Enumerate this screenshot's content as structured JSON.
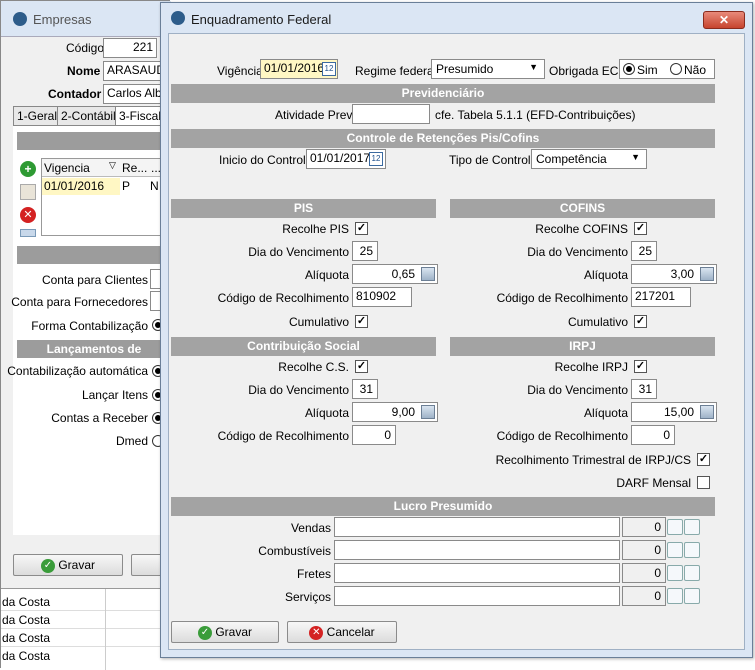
{
  "bg": {
    "title": "Empresas",
    "codigo_label": "Código",
    "codigo_value": "221",
    "nome_label": "Nome",
    "nome_value": "ARASAUDE",
    "contador_label": "Contador",
    "contador_value": "Carlos Alber",
    "tabs": [
      "1-Geral",
      "2-Contábil",
      "3-Fiscal"
    ],
    "grid_headers": [
      "Vigencia",
      "Re...",
      "..."
    ],
    "grid_row": [
      "01/01/2016",
      "P",
      "N"
    ],
    "conta_clientes": "Conta para Clientes",
    "conta_fornecedores": "Conta para Fornecedores",
    "forma_contab": "Forma Contabilização",
    "lanc_header": "Lançamentos de",
    "contab_auto": "Contabilização automática",
    "lancar_itens": "Lançar Itens",
    "contas_receber": "Contas a Receber",
    "dmed": "Dmed",
    "gravar": "Gravar",
    "rows": [
      "da Costa",
      "da Costa",
      "da Costa",
      "da Costa"
    ]
  },
  "dialog": {
    "title": "Enquadramento Federal",
    "vigencia_label": "Vigência",
    "vigencia_value": "01/01/2016",
    "regime_label": "Regime federal",
    "regime_value": "Presumido",
    "ecd_label": "Obrigada ECD",
    "ecd_sim": "Sim",
    "ecd_nao": "Não",
    "prev_header": "Previdenciário",
    "atividade_label": "Atividade Prev.",
    "atividade_value": "",
    "cfe_text": "cfe. Tabela 5.1.1 (EFD-Contribuições)",
    "retencoes_header": "Controle de Retenções Pis/Cofins",
    "inicio_label": "Inicio do Controle",
    "inicio_value": "01/01/2017",
    "tipo_label": "Tipo de Controle",
    "tipo_value": "Competência",
    "pis": {
      "header": "PIS",
      "recolhe_label": "Recolhe PIS",
      "dia_label": "Dia do Vencimento",
      "dia_value": "25",
      "aliquota_label": "Alíquota",
      "aliquota_value": "0,65",
      "codigo_label": "Código de Recolhimento",
      "codigo_value": "810902",
      "cumulativo_label": "Cumulativo"
    },
    "cofins": {
      "header": "COFINS",
      "recolhe_label": "Recolhe COFINS",
      "dia_label": "Dia do Vencimento",
      "dia_value": "25",
      "aliquota_label": "Alíquota",
      "aliquota_value": "3,00",
      "codigo_label": "Código de Recolhimento",
      "codigo_value": "217201",
      "cumulativo_label": "Cumulativo"
    },
    "cs": {
      "header": "Contribuição Social",
      "recolhe_label": "Recolhe C.S.",
      "dia_label": "Dia do Vencimento",
      "dia_value": "31",
      "aliquota_label": "Alíquota",
      "aliquota_value": "9,00",
      "codigo_label": "Código de Recolhimento",
      "codigo_value": "0"
    },
    "irpj": {
      "header": "IRPJ",
      "recolhe_label": "Recolhe IRPJ",
      "dia_label": "Dia do Vencimento",
      "dia_value": "31",
      "aliquota_label": "Alíquota",
      "aliquota_value": "15,00",
      "codigo_label": "Código de Recolhimento",
      "codigo_value": "0",
      "trimestral_label": "Recolhimento Trimestral de IRPJ/CS",
      "darf_label": "DARF Mensal"
    },
    "lucro_header": "Lucro Presumido",
    "lucro_rows": [
      {
        "label": "Vendas",
        "value": "0"
      },
      {
        "label": "Combustíveis",
        "value": "0"
      },
      {
        "label": "Fretes",
        "value": "0"
      },
      {
        "label": "Serviços",
        "value": "0"
      }
    ],
    "gravar": "Gravar",
    "cancelar": "Cancelar",
    "checkmark": "✓"
  }
}
